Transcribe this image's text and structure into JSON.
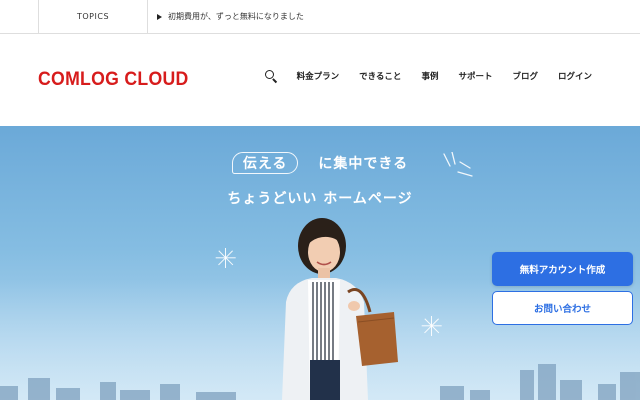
{
  "topics": {
    "label": "TOPICS",
    "item": "初期費用が、ずっと無料になりました"
  },
  "header": {
    "logo": "COMLOG CLOUD",
    "nav": [
      "料金プラン",
      "できること",
      "事例",
      "サポート",
      "ブログ",
      "ログイン"
    ]
  },
  "hero": {
    "bubble_word": "伝える",
    "tagline_rest": "に集中できる",
    "tagline2": "ちょうどいい ホームページ"
  },
  "cta": {
    "primary": "無料アカウント作成",
    "secondary": "お問い合わせ"
  },
  "colors": {
    "brand": "#d71c1c",
    "accent": "#2d6fe3"
  }
}
